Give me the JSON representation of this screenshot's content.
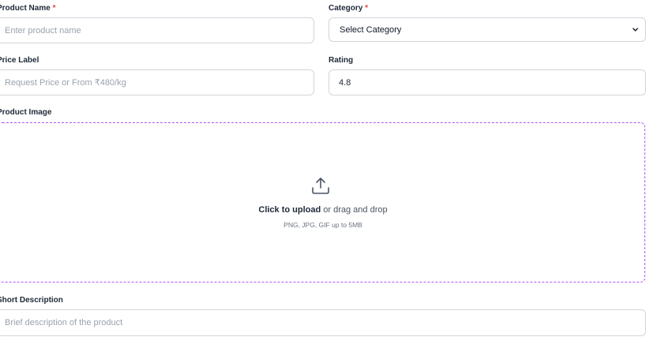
{
  "form": {
    "product_name": {
      "label": "Product Name",
      "required_mark": "*",
      "placeholder": "Enter product name",
      "value": ""
    },
    "category": {
      "label": "Category",
      "required_mark": "*",
      "selected": "Select Category"
    },
    "price_label": {
      "label": "Price Label",
      "placeholder": "Request Price or From ₹480/kg",
      "value": ""
    },
    "rating": {
      "label": "Rating",
      "value": "4.8"
    },
    "product_image": {
      "label": "Product Image",
      "upload_action": "Click to upload",
      "upload_rest": " or drag and drop",
      "upload_hint": "PNG, JPG, GIF up to 5MB"
    },
    "short_description": {
      "label": "Short Description",
      "placeholder": "Brief description of the product",
      "value": ""
    }
  },
  "colors": {
    "required": "#e53e3e",
    "dropzone_border": "#a855f7",
    "input_border": "#d1d5db"
  },
  "icons": {
    "upload": "upload-icon",
    "select_arrow": "chevron-down-icon"
  }
}
